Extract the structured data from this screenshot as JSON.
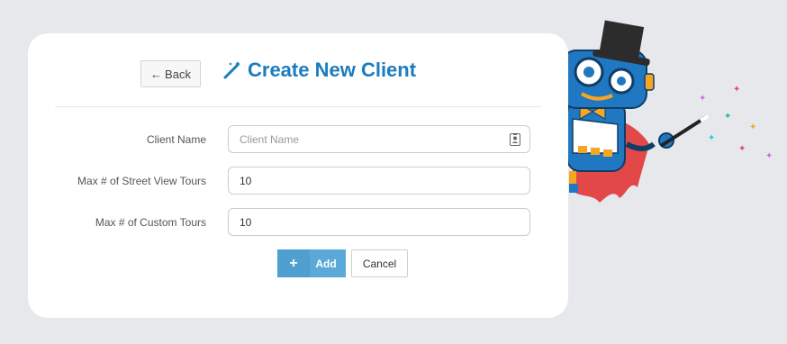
{
  "header": {
    "back_label": "Back",
    "back_icon": "arrow-left-icon",
    "title": "Create New Client",
    "title_icon": "magic-wand-icon"
  },
  "form": {
    "fields": [
      {
        "label": "Client Name",
        "value": "",
        "placeholder": "Client Name",
        "icon": "contact-card-icon"
      },
      {
        "label": "Max # of Street View Tours",
        "value": "10",
        "placeholder": ""
      },
      {
        "label": "Max # of Custom Tours",
        "value": "10",
        "placeholder": ""
      }
    ],
    "add_label": "Add",
    "add_icon": "plus-icon",
    "cancel_label": "Cancel"
  },
  "colors": {
    "background": "#e6e8ec",
    "title": "#1c7cbc",
    "add_button": "#5aa9d8",
    "robot_body": "#1f78c1",
    "robot_cape": "#e34848"
  },
  "illustration": "robot-magician-illustration"
}
